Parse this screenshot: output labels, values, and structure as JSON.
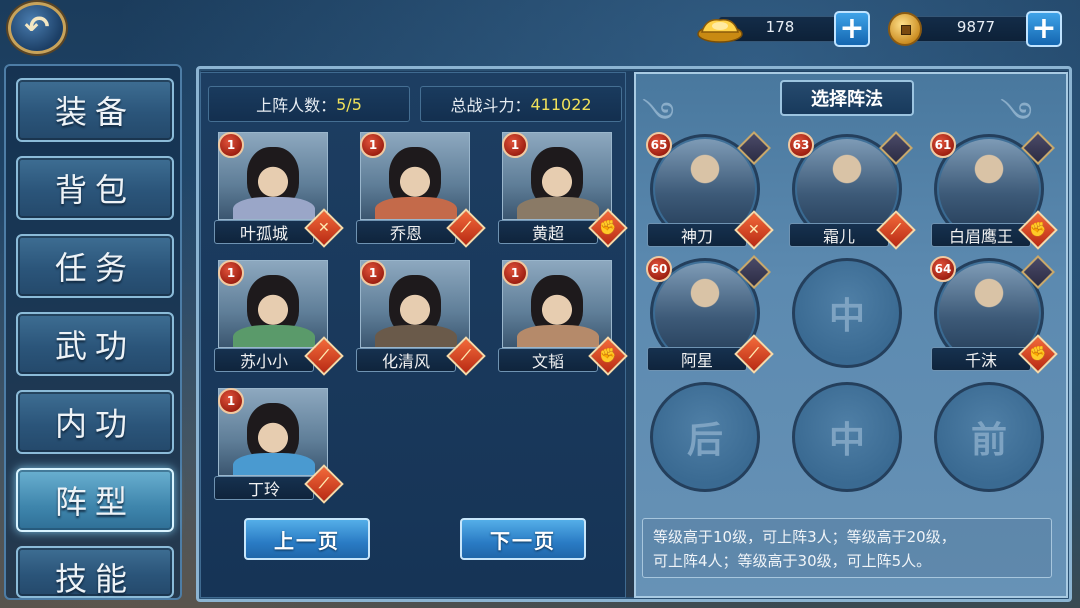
{
  "top": {
    "gold_value": "178",
    "copper_value": "9877",
    "plus_label": "+",
    "back_glyph": "↶"
  },
  "menu": {
    "items": [
      {
        "label": "装备"
      },
      {
        "label": "背包"
      },
      {
        "label": "任务"
      },
      {
        "label": "武功"
      },
      {
        "label": "内功"
      },
      {
        "label": "阵型",
        "active": true
      },
      {
        "label": "技能"
      }
    ]
  },
  "stats": {
    "deploy_label": "上阵人数：",
    "deploy_value": "5/5",
    "power_label": "总战斗力：",
    "power_value": "411022"
  },
  "roster": [
    {
      "name": "叶孤城",
      "level": "1",
      "type_glyph": "✕",
      "type_icon": "crossed-swords-icon"
    },
    {
      "name": "乔恩",
      "level": "1",
      "type_glyph": "⟋",
      "type_icon": "dagger-icon"
    },
    {
      "name": "黄超",
      "level": "1",
      "type_glyph": "✊",
      "type_icon": "fist-icon"
    },
    {
      "name": "苏小小",
      "level": "1",
      "type_glyph": "⟋",
      "type_icon": "dagger-icon"
    },
    {
      "name": "化清风",
      "level": "1",
      "type_glyph": "⟋",
      "type_icon": "dagger-icon"
    },
    {
      "name": "文韬",
      "level": "1",
      "type_glyph": "✊",
      "type_icon": "fist-icon"
    },
    {
      "name": "丁玲",
      "level": "1",
      "type_glyph": "⟋",
      "type_icon": "dagger-icon"
    }
  ],
  "pager": {
    "prev_label": "上一页",
    "next_label": "下一页"
  },
  "formation": {
    "title": "选择阵法",
    "slots": [
      {
        "name": "神刀",
        "level": "65",
        "type_glyph": "✕"
      },
      {
        "name": "霜儿",
        "level": "63",
        "type_glyph": "⟋"
      },
      {
        "name": "白眉鹰王",
        "level": "61",
        "type_glyph": "✊"
      },
      {
        "name": "阿星",
        "level": "60",
        "type_glyph": "⟋"
      },
      {
        "empty": "中"
      },
      {
        "name": "千沫",
        "level": "64",
        "type_glyph": "✊"
      },
      {
        "empty": "后"
      },
      {
        "empty": "中"
      },
      {
        "empty": "前"
      }
    ],
    "info_line1": "等级高于10级，可上阵3人；等级高于20级，",
    "info_line2": "可上阵4人；等级高于30级，可上阵5人。"
  },
  "colors": {
    "accent_yellow": "#f0e15a",
    "button_blue": "#2a7bc4",
    "level_red": "#c0301c"
  }
}
